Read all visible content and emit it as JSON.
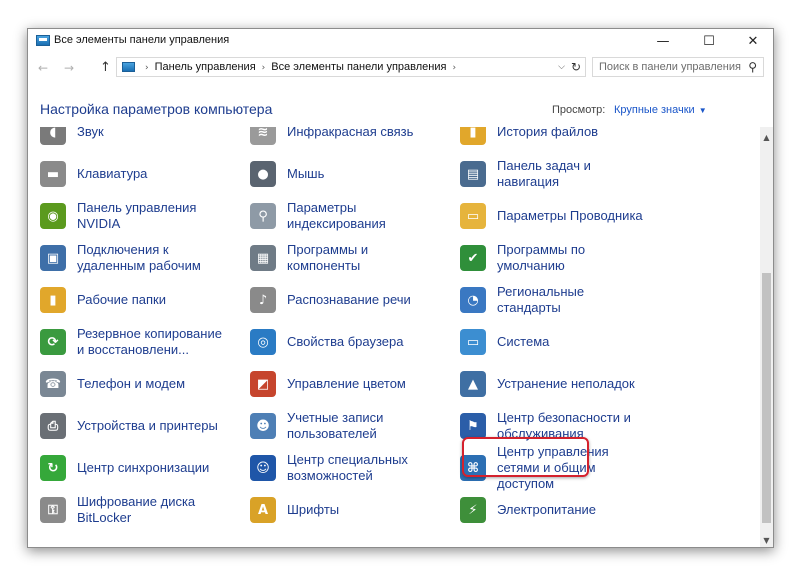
{
  "window": {
    "title": "Все элементы панели управления"
  },
  "controls": {
    "minimize": "—",
    "maximize": "☐",
    "close": "✕"
  },
  "nav": {
    "back": "←",
    "forward": "→",
    "up": "↑",
    "breadcrumbs": [
      "Панель управления",
      "Все элементы панели управления"
    ],
    "sep": "›",
    "dropdown": "⌵",
    "refresh": "↻"
  },
  "search": {
    "placeholder": "Поиск в панели управления",
    "icon": "⚲"
  },
  "header": {
    "title": "Настройка параметров компьютера",
    "view_label": "Просмотр:",
    "view_value": "Крупные значки",
    "view_caret": "▼"
  },
  "items": [
    {
      "label": "Звук",
      "icon": "speaker-icon",
      "glyph": "◖",
      "color": "#7a7a7a"
    },
    {
      "label": "Инфракрасная связь",
      "icon": "infrared-icon",
      "glyph": "≋",
      "color": "#9a9a9a"
    },
    {
      "label": "История файлов",
      "icon": "file-history-icon",
      "glyph": "▮",
      "color": "#e1a72b"
    },
    {
      "label": "Клавиатура",
      "icon": "keyboard-icon",
      "glyph": "▬",
      "color": "#8a8a8a"
    },
    {
      "label": "Мышь",
      "icon": "mouse-icon",
      "glyph": "●",
      "color": "#5a6470"
    },
    {
      "label": "Панель задач и навигация",
      "icon": "taskbar-icon",
      "glyph": "▤",
      "color": "#4a6b8f"
    },
    {
      "label": "Панель управления NVIDIA",
      "icon": "nvidia-icon",
      "glyph": "◉",
      "color": "#5b9a1e"
    },
    {
      "label": "Параметры индексирования",
      "icon": "indexing-icon",
      "glyph": "⚲",
      "color": "#8e9aa6"
    },
    {
      "label": "Параметры Проводника",
      "icon": "folder-options-icon",
      "glyph": "▭",
      "color": "#e6b43c"
    },
    {
      "label": "Подключения к удаленным рабочим",
      "icon": "remote-desktop-icon",
      "glyph": "▣",
      "color": "#3e6fa8"
    },
    {
      "label": "Программы и компоненты",
      "icon": "programs-icon",
      "glyph": "▦",
      "color": "#6f7b86"
    },
    {
      "label": "Программы по умолчанию",
      "icon": "default-programs-icon",
      "glyph": "✔",
      "color": "#2f8f3a"
    },
    {
      "label": "Рабочие папки",
      "icon": "work-folders-icon",
      "glyph": "▮",
      "color": "#e1a72b"
    },
    {
      "label": "Распознавание речи",
      "icon": "microphone-icon",
      "glyph": "♪",
      "color": "#8a8a8a"
    },
    {
      "label": "Региональные стандарты",
      "icon": "region-icon",
      "glyph": "◔",
      "color": "#3a78c2"
    },
    {
      "label": "Резервное копирование и восстановлени...",
      "icon": "backup-icon",
      "glyph": "⟳",
      "color": "#3a9a3f"
    },
    {
      "label": "Свойства браузера",
      "icon": "internet-options-icon",
      "glyph": "◎",
      "color": "#2a7bc4"
    },
    {
      "label": "Система",
      "icon": "system-icon",
      "glyph": "▭",
      "color": "#3c8ed1"
    },
    {
      "label": "Телефон и модем",
      "icon": "phone-modem-icon",
      "glyph": "☎",
      "color": "#7a8794"
    },
    {
      "label": "Управление цветом",
      "icon": "color-management-icon",
      "glyph": "◩",
      "color": "#c6452d"
    },
    {
      "label": "Устранение неполадок",
      "icon": "troubleshooting-icon",
      "glyph": "▲",
      "color": "#3f6fa3"
    },
    {
      "label": "Устройства и принтеры",
      "icon": "devices-printers-icon",
      "glyph": "⎙",
      "color": "#6a6f75"
    },
    {
      "label": "Учетные записи пользователей",
      "icon": "user-accounts-icon",
      "glyph": "☻",
      "color": "#4e7fb5"
    },
    {
      "label": "Центр безопасности и обслуживания",
      "icon": "security-flag-icon",
      "glyph": "⚑",
      "color": "#2b5ea8"
    },
    {
      "label": "Центр синхронизации",
      "icon": "sync-center-icon",
      "glyph": "↻",
      "color": "#35a83a"
    },
    {
      "label": "Центр специальных возможностей",
      "icon": "accessibility-icon",
      "glyph": "☺",
      "color": "#1f56a8"
    },
    {
      "label": "Центр управления сетями и общим доступом",
      "icon": "network-icon",
      "glyph": "⌘",
      "color": "#2c6fb3"
    },
    {
      "label": "Шифрование диска BitLocker",
      "icon": "bitlocker-icon",
      "glyph": "⚿",
      "color": "#8a8a8a"
    },
    {
      "label": "Шрифты",
      "icon": "fonts-icon",
      "glyph": "A",
      "color": "#d9a227"
    },
    {
      "label": "Электропитание",
      "icon": "power-options-icon",
      "glyph": "⚡",
      "color": "#3e8f3a"
    }
  ],
  "scroll": {
    "up": "▲",
    "down": "▼"
  }
}
